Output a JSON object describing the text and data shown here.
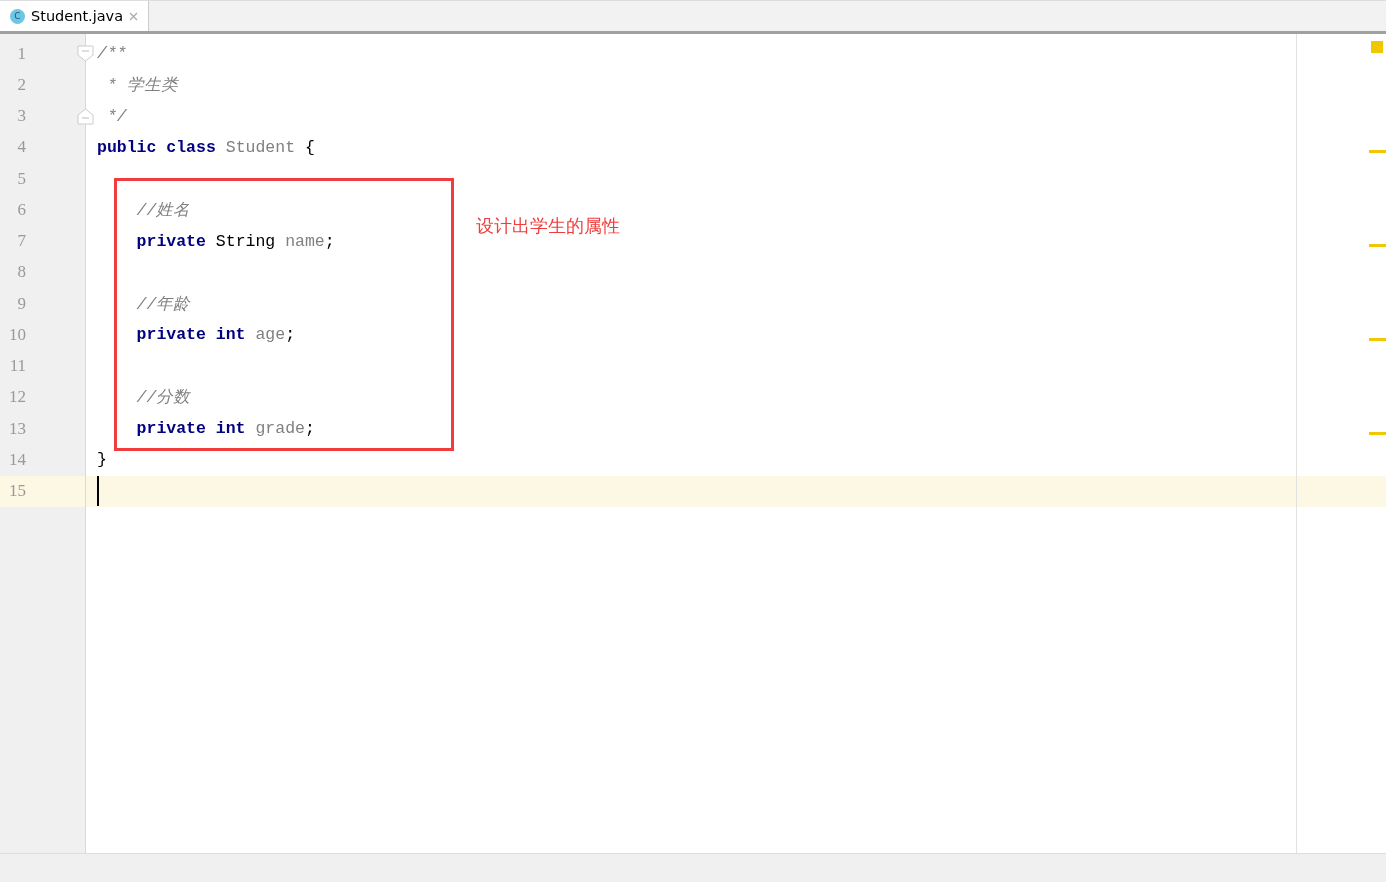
{
  "tabs": [
    {
      "label": "Student.java",
      "icon": "C",
      "selected": true
    }
  ],
  "editor": {
    "lines": [
      {
        "number": "1",
        "fold_open": true,
        "current": false,
        "warning": false,
        "tokens": [
          {
            "text": "/**",
            "kind": "comment"
          }
        ]
      },
      {
        "number": "2",
        "current": false,
        "warning": false,
        "tokens": [
          {
            "text": " * 学生类",
            "kind": "comment"
          }
        ]
      },
      {
        "number": "3",
        "fold_close": true,
        "current": false,
        "warning": false,
        "tokens": [
          {
            "text": " */",
            "kind": "comment"
          }
        ]
      },
      {
        "number": "4",
        "current": false,
        "warning": true,
        "tokens": [
          {
            "text": "public class",
            "kind": "keyword"
          },
          {
            "text": " Student",
            "kind": "unused"
          },
          {
            "text": " {",
            "kind": "plain"
          }
        ]
      },
      {
        "number": "5",
        "current": false,
        "warning": false
      },
      {
        "number": "6",
        "current": false,
        "warning": false,
        "tokens": [
          {
            "text": "    //姓名",
            "kind": "comment"
          }
        ]
      },
      {
        "number": "7",
        "current": false,
        "warning": true,
        "tokens": [
          {
            "text": "    private",
            "kind": "keyword"
          },
          {
            "text": " String ",
            "kind": "plain"
          },
          {
            "text": "name",
            "kind": "unused"
          },
          {
            "text": ";",
            "kind": "plain"
          }
        ]
      },
      {
        "number": "8",
        "current": false,
        "warning": false
      },
      {
        "number": "9",
        "current": false,
        "warning": false,
        "tokens": [
          {
            "text": "    //年龄",
            "kind": "comment"
          }
        ]
      },
      {
        "number": "10",
        "current": false,
        "warning": true,
        "tokens": [
          {
            "text": "    private int",
            "kind": "keyword"
          },
          {
            "text": " age",
            "kind": "unused"
          },
          {
            "text": ";",
            "kind": "plain"
          }
        ]
      },
      {
        "number": "11",
        "current": false,
        "warning": false
      },
      {
        "number": "12",
        "current": false,
        "warning": false,
        "tokens": [
          {
            "text": "    //分数",
            "kind": "comment"
          }
        ]
      },
      {
        "number": "13",
        "current": false,
        "warning": true,
        "tokens": [
          {
            "text": "    private int",
            "kind": "keyword"
          },
          {
            "text": " grade",
            "kind": "unused"
          },
          {
            "text": ";",
            "kind": "plain"
          }
        ]
      },
      {
        "number": "14",
        "current": false,
        "warning": false,
        "tokens": [
          {
            "text": "}",
            "kind": "plain"
          }
        ]
      },
      {
        "number": "15",
        "current": true,
        "warning": false
      }
    ]
  },
  "annotation": {
    "text": "设计出学生的属性"
  }
}
